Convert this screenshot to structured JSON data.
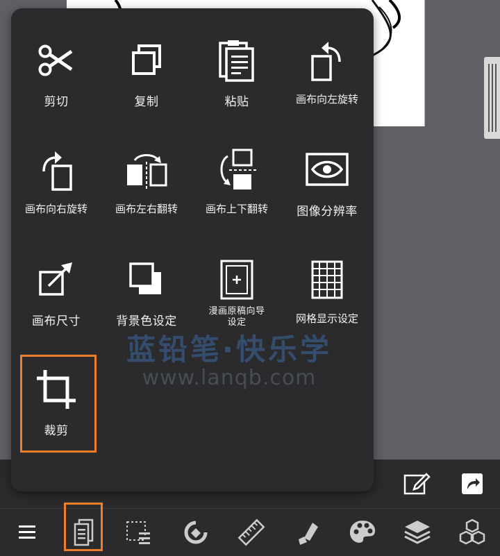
{
  "edit_menu": {
    "items": [
      {
        "label": "剪切",
        "icon": "scissors-icon"
      },
      {
        "label": "复制",
        "icon": "copy-icon"
      },
      {
        "label": "粘贴",
        "icon": "paste-icon"
      },
      {
        "label": "画布向左旋转",
        "icon": "rotate-canvas-left-icon"
      },
      {
        "label": "画布向右旋转",
        "icon": "rotate-canvas-right-icon"
      },
      {
        "label": "画布左右翻转",
        "icon": "flip-horizontal-icon"
      },
      {
        "label": "画布上下翻转",
        "icon": "flip-vertical-icon"
      },
      {
        "label": "图像分辨率",
        "icon": "resolution-eye-icon"
      },
      {
        "label": "画布尺寸",
        "icon": "canvas-size-icon"
      },
      {
        "label": "背景色设定",
        "icon": "background-color-icon"
      },
      {
        "label": "漫画原稿向导设定",
        "icon": "manga-guide-icon"
      },
      {
        "label": "网格显示设定",
        "icon": "grid-icon"
      },
      {
        "label": "裁剪",
        "icon": "crop-icon"
      }
    ]
  },
  "watermark": {
    "line1": "蓝铅笔·快乐学",
    "line2": "www.lanqb.com"
  },
  "bottom_toolbar": {
    "tools": [
      "menu-icon",
      "edit-menu-icon",
      "selection-icon",
      "transform-icon",
      "ruler-icon",
      "fill-icon",
      "color-palette-icon",
      "layers-icon",
      "materials-icon"
    ]
  },
  "accent_color": "#f07d28"
}
